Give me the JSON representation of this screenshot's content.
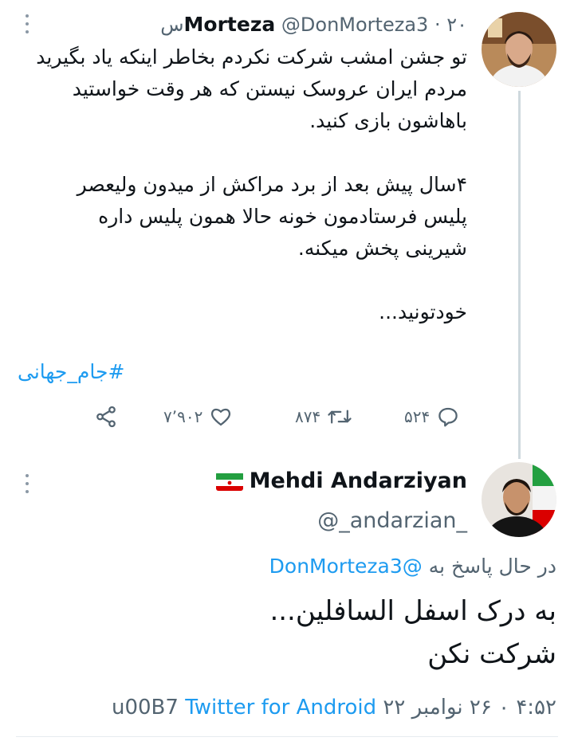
{
  "tweet1": {
    "name": "Morteza",
    "handle": "@DonMorteza3",
    "time": "۲۰س",
    "dot": "·",
    "lines": [
      "تو جشن امشب شرکت نکردم بخاطر اینکه یاد بگیرید",
      "مردم ایران عروسک نیستن که هر وقت خواستید",
      "باهاشون بازی کنید.",
      "",
      "۴سال پیش بعد از برد مراکش از میدون ولیعصر",
      "پلیس فرستادمون خونه حالا همون پلیس داره",
      "شیرینی پخش میکنه.",
      "",
      "خودتونید..."
    ],
    "hashtag": "#جام_جهانی",
    "actions": {
      "replies": "۵۲۴",
      "retweets": "۸۷۴",
      "likes": "۷٬۹۰۲",
      "share_icon": "share-icon"
    }
  },
  "tweet2": {
    "name": "Mehdi Andarziyan",
    "flag": "iran-flag",
    "handle": "@_andarzian_",
    "reply_prefix": "در حال پاسخ به",
    "reply_mention": "@DonMorteza3",
    "body_lines": [
      "به درک اسفل السافلین...",
      "شرکت نکن"
    ],
    "meta_time_date": "۴:۵۲ ۰ ۲۶ نوامبر ۲۲",
    "meta_sep": "u00B7",
    "meta_source": "Twitter for Android"
  },
  "colors": {
    "link": "#1d9bf0",
    "muted": "#536471",
    "text": "#0f1419",
    "thread_line": "#cfd9de"
  }
}
